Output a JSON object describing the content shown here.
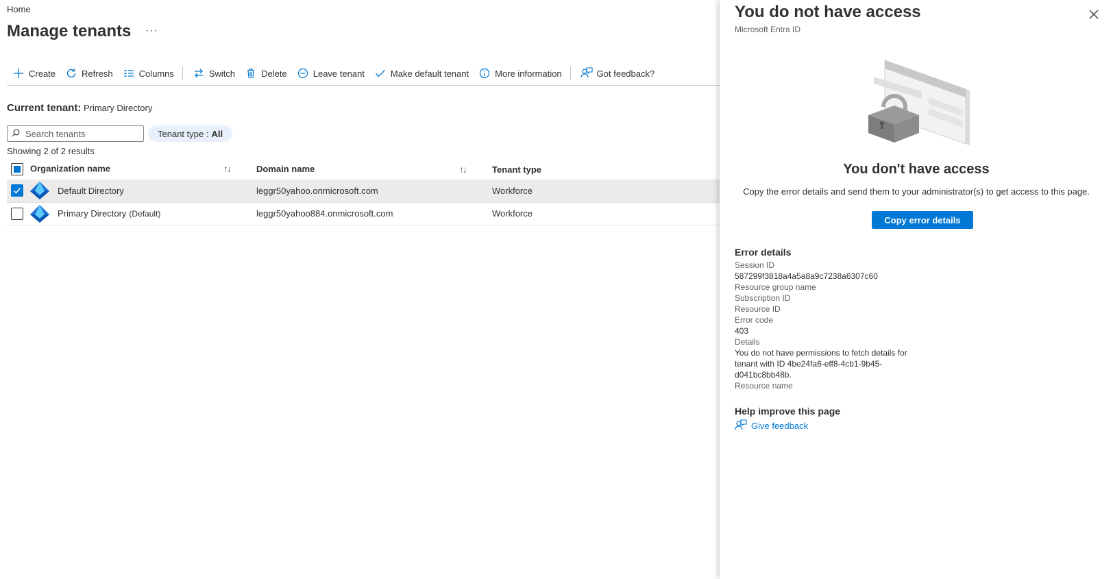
{
  "breadcrumb": "Home",
  "page": {
    "title": "Manage tenants",
    "more": "···"
  },
  "toolbar": {
    "create": "Create",
    "refresh": "Refresh",
    "columns": "Columns",
    "switch": "Switch",
    "delete": "Delete",
    "leave": "Leave tenant",
    "make_default": "Make default tenant",
    "more_info": "More information",
    "feedback": "Got feedback?"
  },
  "current_tenant": {
    "label": "Current tenant:",
    "value": "Primary Directory"
  },
  "search": {
    "placeholder": "Search tenants",
    "value": ""
  },
  "filter": {
    "label": "Tenant type :",
    "value": "All"
  },
  "results_text": "Showing 2 of 2 results",
  "table": {
    "columns": [
      "Organization name",
      "Domain name",
      "Tenant type"
    ],
    "rows": [
      {
        "name": "Default Directory",
        "suffix": "",
        "domain": "leggr50yahoo.onmicrosoft.com",
        "type": "Workforce",
        "checked": true
      },
      {
        "name": "Primary Directory",
        "suffix": "(Default)",
        "domain": "leggr50yahoo884.onmicrosoft.com",
        "type": "Workforce",
        "checked": false
      }
    ]
  },
  "panel": {
    "title": "You do not have access",
    "subtitle": "Microsoft Entra ID",
    "heading": "You don't have access",
    "description": "Copy the error details and send them to your administrator(s) to get access to this page.",
    "copy_button": "Copy error details",
    "error_details_title": "Error details",
    "session_id_label": "Session ID",
    "session_id": "587299f3818a4a5a8a9c7238a6307c60",
    "resource_group_label": "Resource group name",
    "subscription_label": "Subscription ID",
    "resource_id_label": "Resource ID",
    "error_code_label": "Error code",
    "error_code": "403",
    "details_label": "Details",
    "details_line1": "You do not have permissions to fetch details for",
    "details_line2": "tenant with ID 4be24fa6-eff8-4cb1-9b45-",
    "details_line3": "d041bc8bb48b.",
    "resource_name_label": "Resource name",
    "help_title": "Help improve this page",
    "give_feedback": "Give feedback"
  },
  "colors": {
    "accent": "#0078d4",
    "selected_row": "#edebe9",
    "pill_bg": "#e8f1fb"
  }
}
